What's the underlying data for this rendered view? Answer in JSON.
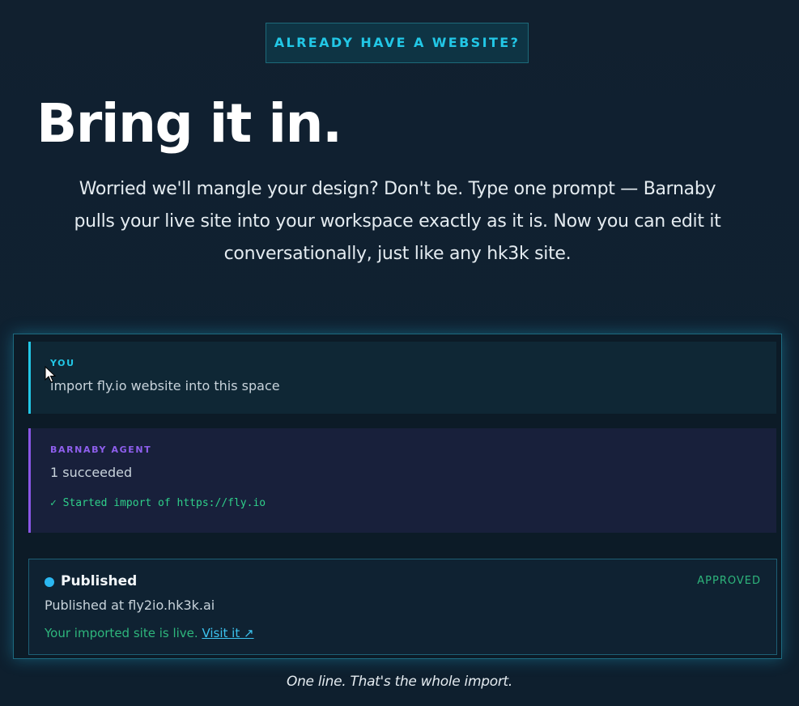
{
  "section": {
    "eyebrow_button": "ALREADY HAVE A WEBSITE?",
    "headline": "Bring it in.",
    "lede": "Worried we'll mangle your design? Don't be. Type one prompt — Barnaby pulls your live site into your workspace exactly as it is. Now you can edit it conversationally, just like any hk3k site."
  },
  "demo": {
    "user_message": {
      "label": "YOU",
      "text": "import fly.io website into this space"
    },
    "agent_message": {
      "label": "BARNABY AGENT",
      "text": "1 succeeded",
      "log": "✓ Started import of https://fly.io"
    },
    "publish_card": {
      "title": "Published",
      "badge": "APPROVED",
      "url_line": "Published at fly2io.hk3k.ai",
      "live_text": "Your imported site is live.",
      "visit_link": "Visit it ↗"
    }
  },
  "caption": "One line. That's the whole import.",
  "icons": {
    "status": "status-dot-icon",
    "cursor": "mouse-cursor-icon"
  },
  "colors": {
    "accent_cyan": "#22c7e6",
    "accent_purple": "#8a57e6",
    "success_green": "#2eb67c",
    "status_blue": "#2bb8f2"
  }
}
